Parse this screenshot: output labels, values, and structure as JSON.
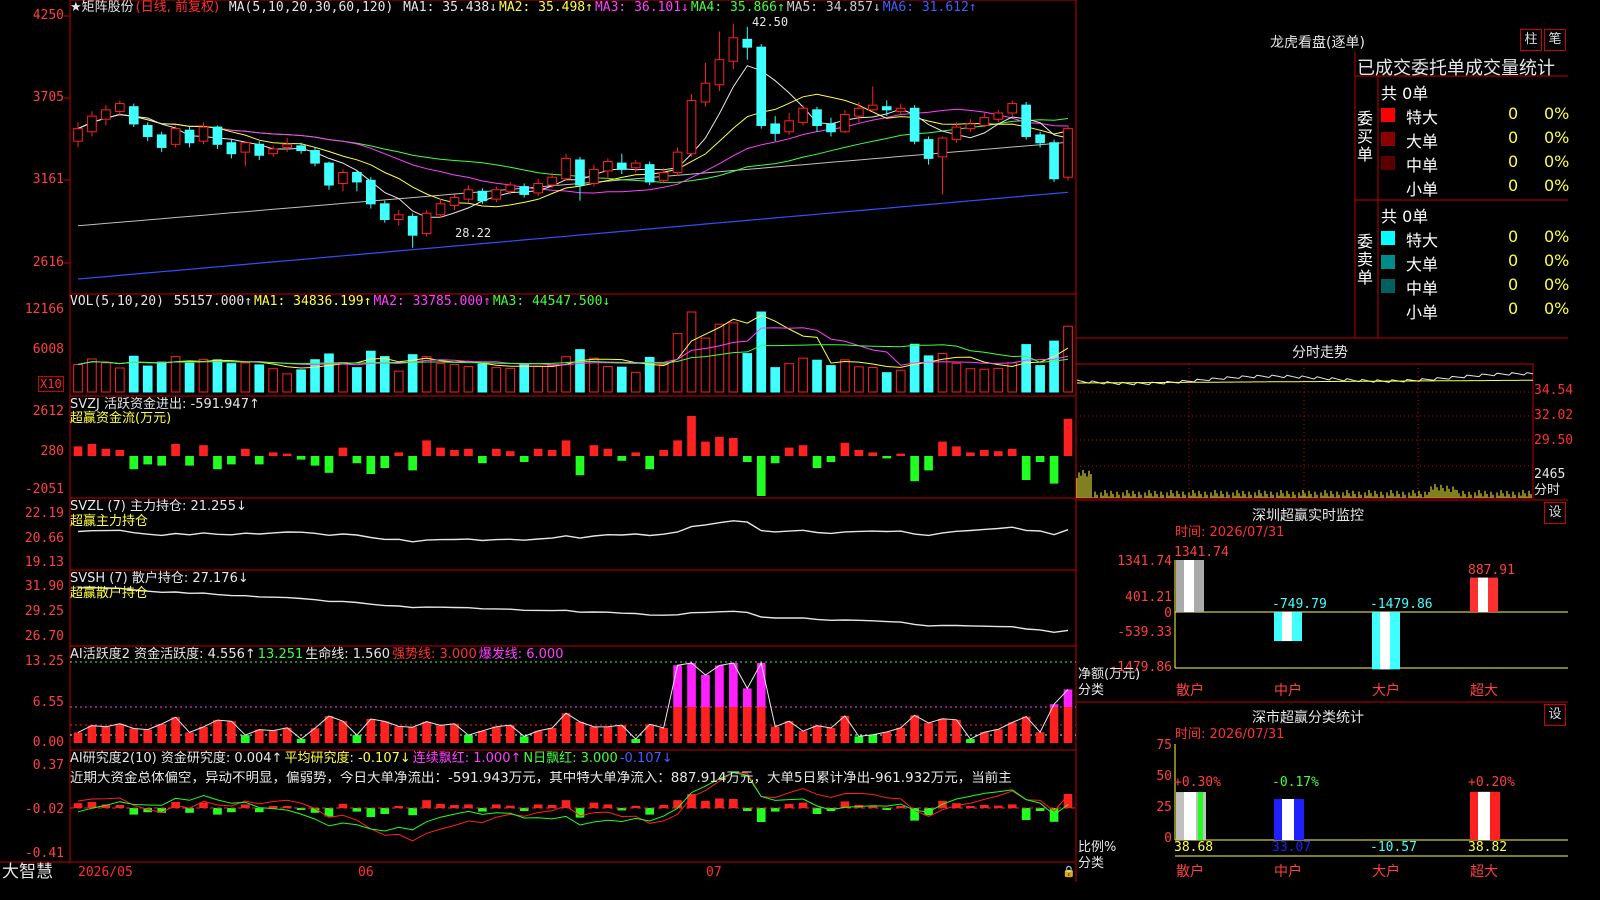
{
  "main": {
    "title": "★矩阵股份",
    "period": "(日线, 前复权)",
    "ma_label": "MA(5,10,20,30,60,120)",
    "ma_values": [
      {
        "name": "MA1:",
        "value": "35.438↓",
        "color": "#e6e6e6"
      },
      {
        "name": "MA2:",
        "value": "35.498↑",
        "color": "#ffff40"
      },
      {
        "name": "MA3:",
        "value": "36.101↓",
        "color": "#ff40ff"
      },
      {
        "name": "MA4:",
        "value": "35.866↑",
        "color": "#40ff40"
      },
      {
        "name": "MA5:",
        "value": "34.857↓",
        "color": "#cccccc"
      },
      {
        "name": "MA6:",
        "value": "31.612↑",
        "color": "#4060ff"
      }
    ],
    "y_ticks": [
      "4250",
      "3705",
      "3161",
      "2616"
    ],
    "high_mark": "42.50",
    "low_mark": "28.22"
  },
  "vol": {
    "label": "VOL(5,10,20)",
    "value": "55157.000↑",
    "ma1": "MA1: 34836.199↑",
    "ma2": "MA2: 33785.000↑",
    "ma3": "MA3: 44547.500↓",
    "y_ticks": [
      "12166",
      "6008"
    ],
    "unit": "X10"
  },
  "svzj": {
    "label": "SVZJ  活跃资金进出: -591.947↑",
    "sub": "超赢资金流(万元)",
    "y_ticks": [
      "2612",
      "280",
      "-2051"
    ]
  },
  "svzl": {
    "label": "SVZL (7) 主力持仓: 21.255↓",
    "sub": "超赢主力持仓",
    "y_ticks": [
      "22.19",
      "20.66",
      "19.13"
    ]
  },
  "svsh": {
    "label": "SVSH (7) 散户持仓: 27.176↓",
    "sub": "超赢散户持仓",
    "y_ticks": [
      "31.90",
      "29.25",
      "26.70"
    ]
  },
  "ai1": {
    "label": "AI活跃度2 资金活跃度: 4.556↑",
    "v2": "13.251",
    "v3": "生命线: 1.560",
    "v4": "强势线: 3.000",
    "v5": "爆发线: 6.000",
    "y_ticks": [
      "13.25",
      "6.55",
      "0.00"
    ]
  },
  "ai2": {
    "label": "AI研究度2(10) 资金研究度: 0.004↑",
    "v2": "平均研究度: -0.107↓",
    "v3": "连续飘红: 1.000↑",
    "v4": "N日飘红: 3.000",
    "v5": "-0.107↓",
    "text": "近期大资金总体偏空，异动不明显，偏弱势，今日大单净流出：-591.943万元，其中特大单净流入：887.914万元，大单5日累计净出-961.932万元，当前主",
    "y_ticks": [
      "0.37",
      "-0.02",
      "-0.41"
    ]
  },
  "xaxis": {
    "brand": "大智慧",
    "labels": [
      "2026/05",
      "06",
      "07"
    ]
  },
  "right": {
    "lhb_title": "龙虎看盘(逐单)",
    "btn1": "柱",
    "btn2": "笔",
    "stat_title": "已成交委托单成交量统计",
    "buy_group": "委买单",
    "sell_group": "委卖单",
    "buy_total": "共 0单",
    "sell_total": "共 0单",
    "buy_rows": [
      {
        "name": "特大",
        "count": "0",
        "pct": "0%",
        "color": "#ff0000"
      },
      {
        "name": "大单",
        "count": "0",
        "pct": "0%",
        "color": "#8b0000"
      },
      {
        "name": "中单",
        "count": "0",
        "pct": "0%",
        "color": "#5a0000"
      },
      {
        "name": "小单",
        "count": "0",
        "pct": "0%",
        "color": ""
      }
    ],
    "sell_rows": [
      {
        "name": "特大",
        "count": "0",
        "pct": "0%",
        "color": "#00ffff"
      },
      {
        "name": "大单",
        "count": "0",
        "pct": "0%",
        "color": "#008b8b"
      },
      {
        "name": "中单",
        "count": "0",
        "pct": "0%",
        "color": "#006060"
      },
      {
        "name": "小单",
        "count": "0",
        "pct": "0%",
        "color": ""
      }
    ],
    "fs_title": "分时走势",
    "fs_ticks": [
      "34.54",
      "32.02",
      "29.50",
      "2465",
      "分时"
    ],
    "sz_title": "深圳超赢实时监控",
    "sz_btn": "设",
    "sz_time": "时间: 2026/07/31",
    "sz_ticks": [
      "1341.74",
      "401.21",
      "0",
      "-539.33",
      "-1479.86"
    ],
    "sz_axis": "净额(万元)",
    "sz_cat": "分类",
    "sz_bars": [
      {
        "cat": "散户",
        "value": "1341.74"
      },
      {
        "cat": "中户",
        "value": "-749.79"
      },
      {
        "cat": "大户",
        "value": "-1479.86"
      },
      {
        "cat": "超大",
        "value": "887.91"
      }
    ],
    "sc_title": "深市超赢分类统计",
    "sc_btn": "设",
    "sc_time": "时间: 2026/07/31",
    "sc_ticks": [
      "75",
      "50",
      "25",
      "0"
    ],
    "sc_axis": "比例%",
    "sc_cat": "分类",
    "sc_bars": [
      {
        "cat": "散户",
        "top": "+0.30%",
        "value": "38.68"
      },
      {
        "cat": "中户",
        "top": "-0.17%",
        "value": "33.07"
      },
      {
        "cat": "大户",
        "top": "",
        "value": "-10.57"
      },
      {
        "cat": "超大",
        "top": "+0.20%",
        "value": "38.82"
      }
    ]
  },
  "chart_data": {
    "type": "candlestick",
    "x": [
      "2026/05",
      "06",
      "07"
    ],
    "candles": [
      [
        35.0,
        35.8,
        34.6,
        36.2
      ],
      [
        35.6,
        36.6,
        35.3,
        36.9
      ],
      [
        36.4,
        37.0,
        36.0,
        37.3
      ],
      [
        36.9,
        37.4,
        36.6,
        37.6
      ],
      [
        37.2,
        36.1,
        35.9,
        37.4
      ],
      [
        36.0,
        35.3,
        35.0,
        36.2
      ],
      [
        35.4,
        34.6,
        34.3,
        35.6
      ],
      [
        34.8,
        35.8,
        34.6,
        36.0
      ],
      [
        35.7,
        34.9,
        34.6,
        35.9
      ],
      [
        35.0,
        35.9,
        34.8,
        36.2
      ],
      [
        35.9,
        34.8,
        34.5,
        36.0
      ],
      [
        34.9,
        34.2,
        33.9,
        35.1
      ],
      [
        34.3,
        34.9,
        33.4,
        35.0
      ],
      [
        34.8,
        34.1,
        33.8,
        35.0
      ],
      [
        34.2,
        34.5,
        34.0,
        34.7
      ],
      [
        34.6,
        34.8,
        34.3,
        35.2
      ],
      [
        34.7,
        34.4,
        34.2,
        34.9
      ],
      [
        34.4,
        33.6,
        33.4,
        34.6
      ],
      [
        33.6,
        32.2,
        31.9,
        33.7
      ],
      [
        32.3,
        33.0,
        31.8,
        33.2
      ],
      [
        33.0,
        32.4,
        31.8,
        33.1
      ],
      [
        32.5,
        31.0,
        30.7,
        32.7
      ],
      [
        31.0,
        30.0,
        29.8,
        31.2
      ],
      [
        30.0,
        30.3,
        29.6,
        30.6
      ],
      [
        30.2,
        29.0,
        28.2,
        30.4
      ],
      [
        29.1,
        30.4,
        28.9,
        30.6
      ],
      [
        30.3,
        31.0,
        30.1,
        31.3
      ],
      [
        30.9,
        31.4,
        30.6,
        31.6
      ],
      [
        31.3,
        31.9,
        31.1,
        32.2
      ],
      [
        31.8,
        31.2,
        31.0,
        32.0
      ],
      [
        31.3,
        31.9,
        31.1,
        32.1
      ],
      [
        31.8,
        32.2,
        31.6,
        32.4
      ],
      [
        32.1,
        31.6,
        31.4,
        32.3
      ],
      [
        31.7,
        32.3,
        31.5,
        32.6
      ],
      [
        32.2,
        32.7,
        32.0,
        33.0
      ],
      [
        32.6,
        33.9,
        32.5,
        34.2
      ],
      [
        33.8,
        32.2,
        31.2,
        34.0
      ],
      [
        32.3,
        33.2,
        32.1,
        33.5
      ],
      [
        33.1,
        33.7,
        32.6,
        33.9
      ],
      [
        33.6,
        33.2,
        32.9,
        34.2
      ],
      [
        33.3,
        33.6,
        33.0,
        33.8
      ],
      [
        33.5,
        32.4,
        32.2,
        33.7
      ],
      [
        32.5,
        33.0,
        32.3,
        33.3
      ],
      [
        33.0,
        34.3,
        32.8,
        34.6
      ],
      [
        34.2,
        37.6,
        34.0,
        38.0
      ],
      [
        37.5,
        38.7,
        37.2,
        40.0
      ],
      [
        38.6,
        40.2,
        38.2,
        42.0
      ],
      [
        40.1,
        41.6,
        39.6,
        42.5
      ],
      [
        41.5,
        41.0,
        40.2,
        42.3
      ],
      [
        41.0,
        36.0,
        35.8,
        41.2
      ],
      [
        36.1,
        35.5,
        35.0,
        36.6
      ],
      [
        35.6,
        36.3,
        35.4,
        36.8
      ],
      [
        36.2,
        37.1,
        36.0,
        37.3
      ],
      [
        37.0,
        36.0,
        35.6,
        37.2
      ],
      [
        36.1,
        35.6,
        35.3,
        36.5
      ],
      [
        35.6,
        36.7,
        35.5,
        37.0
      ],
      [
        36.6,
        37.1,
        36.2,
        37.5
      ],
      [
        37.0,
        37.3,
        36.8,
        38.5
      ],
      [
        37.2,
        37.0,
        36.6,
        37.6
      ],
      [
        36.9,
        37.1,
        36.7,
        37.4
      ],
      [
        37.1,
        35.0,
        34.8,
        37.3
      ],
      [
        35.1,
        33.9,
        33.5,
        35.3
      ],
      [
        34.0,
        35.2,
        31.6,
        35.3
      ],
      [
        35.1,
        35.9,
        34.9,
        36.2
      ],
      [
        35.8,
        36.1,
        35.6,
        36.4
      ],
      [
        36.0,
        36.5,
        35.9,
        36.8
      ],
      [
        36.4,
        36.8,
        36.2,
        37.0
      ],
      [
        36.8,
        37.4,
        36.6,
        37.6
      ],
      [
        37.3,
        35.3,
        35.1,
        37.5
      ],
      [
        35.4,
        34.9,
        34.6,
        35.6
      ],
      [
        34.9,
        32.6,
        32.4,
        35.1
      ],
      [
        32.7,
        35.8,
        32.5,
        36.0
      ]
    ],
    "ylim": [
      25.5,
      43.5
    ]
  }
}
